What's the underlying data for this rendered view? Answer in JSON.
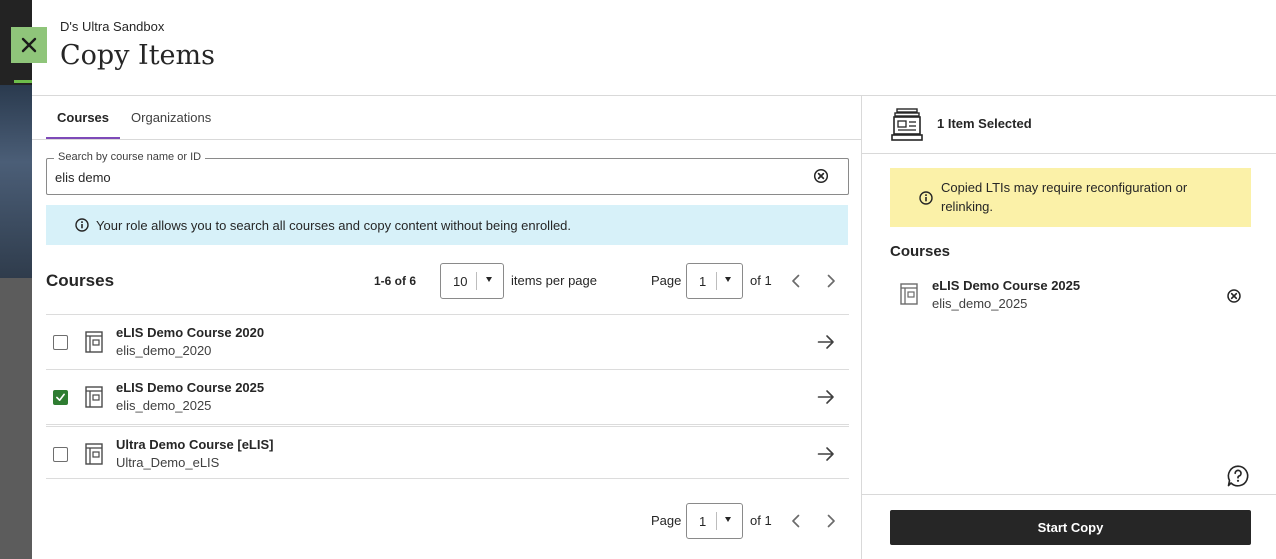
{
  "header": {
    "breadcrumb": "D's Ultra Sandbox",
    "title": "Copy Items"
  },
  "tabs": [
    {
      "label": "Courses",
      "active": true
    },
    {
      "label": "Organizations",
      "active": false
    }
  ],
  "search": {
    "label": "Search by course name or ID",
    "value": "elis demo"
  },
  "info_banner": "Your role allows you to search all courses and copy content without being enrolled.",
  "list": {
    "title": "Courses",
    "range": "1-6 of 6",
    "per_page_value": "10",
    "per_page_label": "items per page",
    "page_label": "Page",
    "page_value": "1",
    "of_label": "of 1"
  },
  "courses": [
    {
      "name": "eLIS Demo Course 2020",
      "id": "elis_demo_2020",
      "checked": false
    },
    {
      "name": "eLIS Demo Course 2025",
      "id": "elis_demo_2025",
      "checked": true
    },
    {
      "name": "Ultra Demo Course [eLIS]",
      "id": "Ultra_Demo_eLIS",
      "checked": false
    }
  ],
  "footer_pager": {
    "page_label": "Page",
    "page_value": "1",
    "of_label": "of 1"
  },
  "selection": {
    "count_label": "1 Item Selected",
    "warning": "Copied LTIs may require reconfiguration or relinking.",
    "section_title": "Courses",
    "items": [
      {
        "name": "eLIS Demo Course 2025",
        "id": "elis_demo_2025"
      }
    ],
    "start_label": "Start Copy"
  },
  "colors": {
    "accent_tab": "#7e4ab8",
    "checkbox_checked": "#2f7d32",
    "info_bg": "#d7f1f9",
    "warn_bg": "#fbf1a8",
    "primary_button": "#262626",
    "close_button": "#8fc57a"
  },
  "icons": {
    "close": "close-icon",
    "search_clear": "clear-circle-icon",
    "info": "info-icon",
    "course": "course-book-icon",
    "arrow": "arrow-right-icon",
    "chevron_left": "chevron-left-icon",
    "chevron_right": "chevron-right-icon",
    "selection": "copy-tray-icon",
    "help": "help-icon"
  }
}
